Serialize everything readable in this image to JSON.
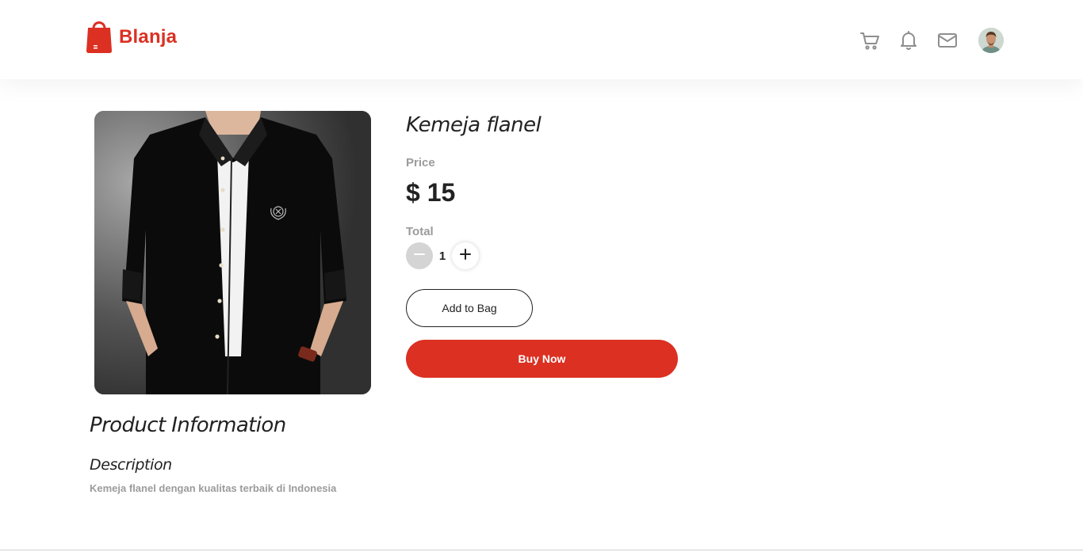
{
  "brand": {
    "name": "Blanja",
    "color": "#db3022",
    "logo_icon": "shopping-bag-icon"
  },
  "nav": {
    "icons": [
      "cart-icon",
      "bell-icon",
      "mail-icon"
    ],
    "avatar_icon": "user-avatar"
  },
  "product": {
    "image_icon": "black-shirt-photo",
    "title": "Kemeja flanel",
    "price_label": "Price",
    "price": "$ 15",
    "total_label": "Total",
    "quantity": "1",
    "add_to_bag_label": "Add to Bag",
    "buy_now_label": "Buy Now"
  },
  "info": {
    "title": "Product Information",
    "description_title": "Description",
    "description": "Kemeja flanel dengan kualitas terbaik di Indonesia"
  },
  "colors": {
    "accent": "#db3022",
    "muted_text": "#9b9b9b",
    "text": "#222222"
  }
}
